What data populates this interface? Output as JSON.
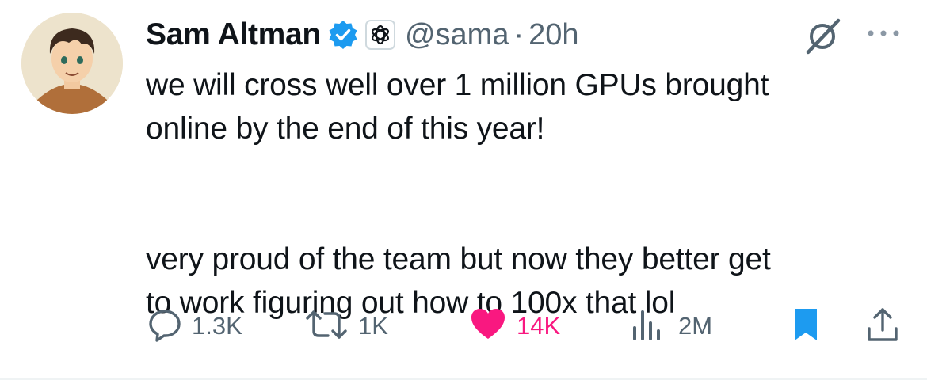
{
  "author": {
    "name": "Sam Altman",
    "handle": "@sama",
    "separator": "·",
    "time": "20h",
    "verified_color": "#1d9bf0"
  },
  "tweet": {
    "lines_paragraph_1": [
      "we will cross well over 1 million GPUs brought",
      "online by the end of this year!"
    ],
    "lines_paragraph_2": [
      "very proud of the team but now they better get",
      "to work figuring out how to 100x that lol"
    ]
  },
  "actions": {
    "replies": "1.3K",
    "reposts": "1K",
    "likes": "14K",
    "views": "2M",
    "like_color": "#f91880",
    "bookmark_color": "#1d9bf0",
    "icons": [
      "reply-icon",
      "repost-icon",
      "like-icon",
      "views-icon",
      "bookmark-icon",
      "share-icon"
    ]
  }
}
